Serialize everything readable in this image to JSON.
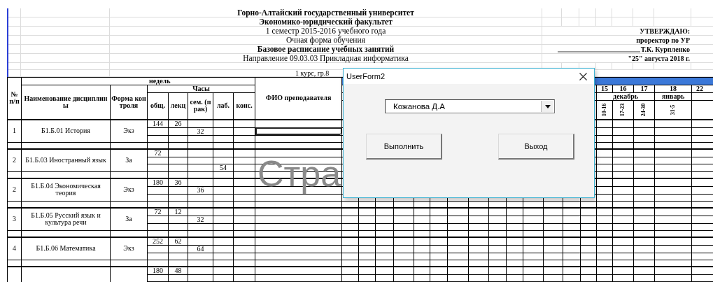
{
  "header": {
    "lines": [
      {
        "title": "Горно-Алтайский государственный университет",
        "bold": true
      },
      {
        "title": "Экономико-юридический факультет",
        "bold": true
      },
      {
        "title": "1 семестр 2015-2016 учебного года",
        "bold": false,
        "approval": "УТВЕРЖДАЮ:"
      },
      {
        "title": "Очная форма обучения",
        "bold": false,
        "approval": "проректор по УР"
      },
      {
        "title": "Базовое расписание учебных занятий",
        "bold": true,
        "approval": "Т.К. Курпленко",
        "kind": "signature"
      },
      {
        "title": "Направление 09.03.03 Прикладная информатика",
        "bold": false,
        "approval": "\"25\" августа 2018 г."
      }
    ],
    "group": "1 курс, гр.8"
  },
  "table": {
    "weeks_label": "недель",
    "hours_label": "Часы",
    "columns": {
      "num": "№ п/п",
      "name": "Наименование дисциплины",
      "form": "Форма контроля",
      "total": "общ.",
      "lectures": "лекц",
      "seminars": "сем. (прак)",
      "lab": "лаб.",
      "consult": "конс.",
      "teacher": "ФИО преподавателя"
    },
    "weeks": [
      {
        "number": "15",
        "month": "декабрь",
        "dates": "10-16"
      },
      {
        "number": "16",
        "dates": "17-23"
      },
      {
        "number": "17",
        "dates": "24-30"
      },
      {
        "number": "18",
        "month": "январь",
        "dates": "31-5"
      },
      {
        "number": "22",
        "kind": "cut"
      }
    ],
    "records": [
      {
        "num": "1",
        "name": "Б1.Б.01 История",
        "form": "Экз",
        "fio_selected": true,
        "hours": {
          "top": {
            "total": "144",
            "lectures": "26"
          },
          "middle": {
            "seminars": "32"
          }
        }
      },
      {
        "num": "2",
        "name": "Б1.Б.03 Иностранный язык",
        "form": "За",
        "hours": {
          "top": {
            "total": "72"
          },
          "bottom": {
            "lab": "54"
          }
        }
      },
      {
        "num": "2",
        "name": "Б1.Б.04 Экономическая теория",
        "form": "Экз",
        "hours": {
          "top": {
            "total": "180",
            "lectures": "36"
          },
          "middle": {
            "seminars": "36"
          }
        }
      },
      {
        "num": "3",
        "name": "Б1.Б.05 Русский язык и культура речи",
        "form": "За",
        "hours": {
          "top": {
            "total": "72",
            "lectures": "12"
          },
          "middle": {
            "seminars": "32"
          }
        }
      },
      {
        "num": "4",
        "name": "Б1.Б.06 Математика",
        "form": "Экз",
        "hours": {
          "top": {
            "total": "252",
            "lectures": "62"
          },
          "middle": {
            "seminars": "64"
          }
        }
      },
      {
        "hours": {
          "top": {
            "total": "180",
            "lectures": "48"
          }
        }
      }
    ]
  },
  "page_label": "Стра",
  "dialog": {
    "title": "UserForm2",
    "combo_value": "Кожанова Д.А",
    "buttons": [
      {
        "label": "Выполнить"
      },
      {
        "label": "Выход"
      }
    ]
  }
}
